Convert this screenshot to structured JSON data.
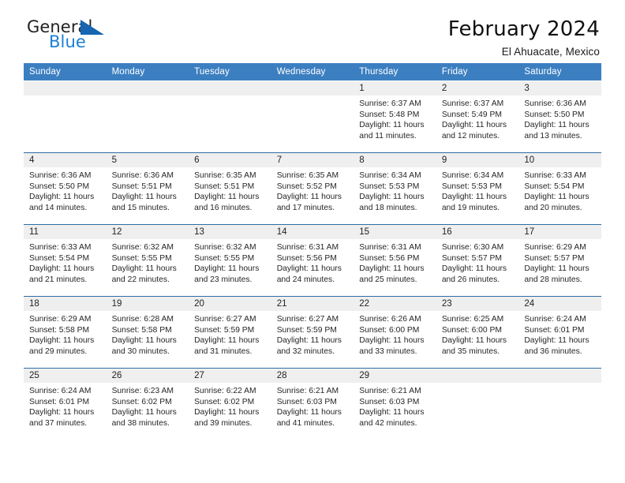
{
  "brand": {
    "word1": "General",
    "word2": "Blue",
    "triangle_color": "#1565b0",
    "blue_color": "#1b7fd4"
  },
  "header": {
    "title": "February 2024",
    "subtitle": "El Ahuacate, Mexico"
  },
  "theme": {
    "header_row_bg": "#3c7fc1",
    "row_divider": "#2e6da4",
    "daynum_band_bg": "#efefef",
    "text": "#262626"
  },
  "weekday_headers": [
    "Sunday",
    "Monday",
    "Tuesday",
    "Wednesday",
    "Thursday",
    "Friday",
    "Saturday"
  ],
  "weeks": [
    [
      {
        "day": "",
        "sunrise": "",
        "sunset": "",
        "daylight_1": "",
        "daylight_2": "",
        "empty": true
      },
      {
        "day": "",
        "sunrise": "",
        "sunset": "",
        "daylight_1": "",
        "daylight_2": "",
        "empty": true
      },
      {
        "day": "",
        "sunrise": "",
        "sunset": "",
        "daylight_1": "",
        "daylight_2": "",
        "empty": true
      },
      {
        "day": "",
        "sunrise": "",
        "sunset": "",
        "daylight_1": "",
        "daylight_2": "",
        "empty": true
      },
      {
        "day": "1",
        "sunrise": "Sunrise: 6:37 AM",
        "sunset": "Sunset: 5:48 PM",
        "daylight_1": "Daylight: 11 hours",
        "daylight_2": "and 11 minutes."
      },
      {
        "day": "2",
        "sunrise": "Sunrise: 6:37 AM",
        "sunset": "Sunset: 5:49 PM",
        "daylight_1": "Daylight: 11 hours",
        "daylight_2": "and 12 minutes."
      },
      {
        "day": "3",
        "sunrise": "Sunrise: 6:36 AM",
        "sunset": "Sunset: 5:50 PM",
        "daylight_1": "Daylight: 11 hours",
        "daylight_2": "and 13 minutes."
      }
    ],
    [
      {
        "day": "4",
        "sunrise": "Sunrise: 6:36 AM",
        "sunset": "Sunset: 5:50 PM",
        "daylight_1": "Daylight: 11 hours",
        "daylight_2": "and 14 minutes."
      },
      {
        "day": "5",
        "sunrise": "Sunrise: 6:36 AM",
        "sunset": "Sunset: 5:51 PM",
        "daylight_1": "Daylight: 11 hours",
        "daylight_2": "and 15 minutes."
      },
      {
        "day": "6",
        "sunrise": "Sunrise: 6:35 AM",
        "sunset": "Sunset: 5:51 PM",
        "daylight_1": "Daylight: 11 hours",
        "daylight_2": "and 16 minutes."
      },
      {
        "day": "7",
        "sunrise": "Sunrise: 6:35 AM",
        "sunset": "Sunset: 5:52 PM",
        "daylight_1": "Daylight: 11 hours",
        "daylight_2": "and 17 minutes."
      },
      {
        "day": "8",
        "sunrise": "Sunrise: 6:34 AM",
        "sunset": "Sunset: 5:53 PM",
        "daylight_1": "Daylight: 11 hours",
        "daylight_2": "and 18 minutes."
      },
      {
        "day": "9",
        "sunrise": "Sunrise: 6:34 AM",
        "sunset": "Sunset: 5:53 PM",
        "daylight_1": "Daylight: 11 hours",
        "daylight_2": "and 19 minutes."
      },
      {
        "day": "10",
        "sunrise": "Sunrise: 6:33 AM",
        "sunset": "Sunset: 5:54 PM",
        "daylight_1": "Daylight: 11 hours",
        "daylight_2": "and 20 minutes."
      }
    ],
    [
      {
        "day": "11",
        "sunrise": "Sunrise: 6:33 AM",
        "sunset": "Sunset: 5:54 PM",
        "daylight_1": "Daylight: 11 hours",
        "daylight_2": "and 21 minutes."
      },
      {
        "day": "12",
        "sunrise": "Sunrise: 6:32 AM",
        "sunset": "Sunset: 5:55 PM",
        "daylight_1": "Daylight: 11 hours",
        "daylight_2": "and 22 minutes."
      },
      {
        "day": "13",
        "sunrise": "Sunrise: 6:32 AM",
        "sunset": "Sunset: 5:55 PM",
        "daylight_1": "Daylight: 11 hours",
        "daylight_2": "and 23 minutes."
      },
      {
        "day": "14",
        "sunrise": "Sunrise: 6:31 AM",
        "sunset": "Sunset: 5:56 PM",
        "daylight_1": "Daylight: 11 hours",
        "daylight_2": "and 24 minutes."
      },
      {
        "day": "15",
        "sunrise": "Sunrise: 6:31 AM",
        "sunset": "Sunset: 5:56 PM",
        "daylight_1": "Daylight: 11 hours",
        "daylight_2": "and 25 minutes."
      },
      {
        "day": "16",
        "sunrise": "Sunrise: 6:30 AM",
        "sunset": "Sunset: 5:57 PM",
        "daylight_1": "Daylight: 11 hours",
        "daylight_2": "and 26 minutes."
      },
      {
        "day": "17",
        "sunrise": "Sunrise: 6:29 AM",
        "sunset": "Sunset: 5:57 PM",
        "daylight_1": "Daylight: 11 hours",
        "daylight_2": "and 28 minutes."
      }
    ],
    [
      {
        "day": "18",
        "sunrise": "Sunrise: 6:29 AM",
        "sunset": "Sunset: 5:58 PM",
        "daylight_1": "Daylight: 11 hours",
        "daylight_2": "and 29 minutes."
      },
      {
        "day": "19",
        "sunrise": "Sunrise: 6:28 AM",
        "sunset": "Sunset: 5:58 PM",
        "daylight_1": "Daylight: 11 hours",
        "daylight_2": "and 30 minutes."
      },
      {
        "day": "20",
        "sunrise": "Sunrise: 6:27 AM",
        "sunset": "Sunset: 5:59 PM",
        "daylight_1": "Daylight: 11 hours",
        "daylight_2": "and 31 minutes."
      },
      {
        "day": "21",
        "sunrise": "Sunrise: 6:27 AM",
        "sunset": "Sunset: 5:59 PM",
        "daylight_1": "Daylight: 11 hours",
        "daylight_2": "and 32 minutes."
      },
      {
        "day": "22",
        "sunrise": "Sunrise: 6:26 AM",
        "sunset": "Sunset: 6:00 PM",
        "daylight_1": "Daylight: 11 hours",
        "daylight_2": "and 33 minutes."
      },
      {
        "day": "23",
        "sunrise": "Sunrise: 6:25 AM",
        "sunset": "Sunset: 6:00 PM",
        "daylight_1": "Daylight: 11 hours",
        "daylight_2": "and 35 minutes."
      },
      {
        "day": "24",
        "sunrise": "Sunrise: 6:24 AM",
        "sunset": "Sunset: 6:01 PM",
        "daylight_1": "Daylight: 11 hours",
        "daylight_2": "and 36 minutes."
      }
    ],
    [
      {
        "day": "25",
        "sunrise": "Sunrise: 6:24 AM",
        "sunset": "Sunset: 6:01 PM",
        "daylight_1": "Daylight: 11 hours",
        "daylight_2": "and 37 minutes."
      },
      {
        "day": "26",
        "sunrise": "Sunrise: 6:23 AM",
        "sunset": "Sunset: 6:02 PM",
        "daylight_1": "Daylight: 11 hours",
        "daylight_2": "and 38 minutes."
      },
      {
        "day": "27",
        "sunrise": "Sunrise: 6:22 AM",
        "sunset": "Sunset: 6:02 PM",
        "daylight_1": "Daylight: 11 hours",
        "daylight_2": "and 39 minutes."
      },
      {
        "day": "28",
        "sunrise": "Sunrise: 6:21 AM",
        "sunset": "Sunset: 6:03 PM",
        "daylight_1": "Daylight: 11 hours",
        "daylight_2": "and 41 minutes."
      },
      {
        "day": "29",
        "sunrise": "Sunrise: 6:21 AM",
        "sunset": "Sunset: 6:03 PM",
        "daylight_1": "Daylight: 11 hours",
        "daylight_2": "and 42 minutes."
      },
      {
        "day": "",
        "sunrise": "",
        "sunset": "",
        "daylight_1": "",
        "daylight_2": "",
        "empty": true
      },
      {
        "day": "",
        "sunrise": "",
        "sunset": "",
        "daylight_1": "",
        "daylight_2": "",
        "empty": true
      }
    ]
  ]
}
